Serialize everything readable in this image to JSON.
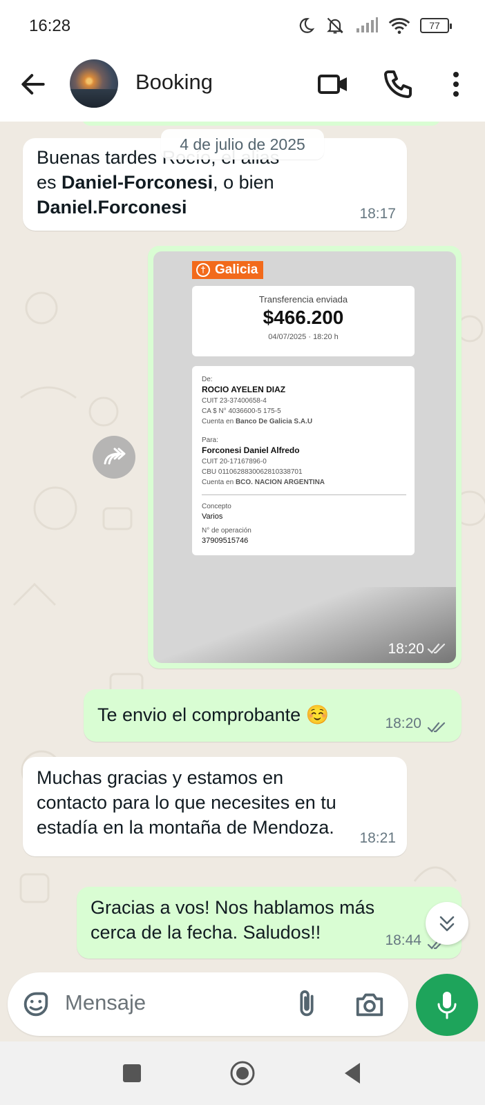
{
  "status_bar": {
    "time": "16:28",
    "battery": "77",
    "icons": [
      "moon-icon",
      "mute-icon",
      "signal-icon",
      "wifi-icon",
      "battery-icon"
    ]
  },
  "header": {
    "contact_name": "Booking",
    "icons": [
      "back-arrow-icon",
      "video-call-icon",
      "phone-icon",
      "more-options-icon"
    ]
  },
  "chat": {
    "date_chip": "4 de julio de 2025",
    "messages": [
      {
        "direction": "in",
        "lines": [
          {
            "parts": [
              {
                "text": "Buenas tardes Rocío, el alias",
                "bold": false
              }
            ]
          },
          {
            "parts": [
              {
                "text": "es ",
                "bold": false
              },
              {
                "text": "Daniel-Forconesi",
                "bold": true
              },
              {
                "text": ", o bien",
                "bold": false
              }
            ]
          },
          {
            "parts": [
              {
                "text": "Daniel.Forconesi",
                "bold": true
              }
            ]
          }
        ],
        "time": "18:17"
      },
      {
        "direction": "out",
        "type": "image",
        "time": "18:20",
        "receipt": {
          "bank": "Galicia",
          "title": "Transferencia enviada",
          "amount": "$466.200",
          "datetime": "04/07/2025 · 18:20 h",
          "from_label": "De:",
          "from_name": "ROCIO AYELEN DIAZ",
          "from_cuit": "CUIT 23-37400658-4",
          "from_account": "CA $ N° 4036600-5 175-5",
          "from_bank_prefix": "Cuenta en",
          "from_bank": "Banco De Galicia S.A.U",
          "to_label": "Para:",
          "to_name": "Forconesi Daniel Alfredo",
          "to_cuit": "CUIT 20-17167896-0",
          "to_cbu": "CBU 0110628830062810338701",
          "to_bank_prefix": "Cuenta en",
          "to_bank": "BCO. NACION ARGENTINA",
          "concept_label": "Concepto",
          "concept_value": "Varios",
          "op_label": "N° de operación",
          "op_value": "37909515746"
        }
      },
      {
        "direction": "out",
        "text": "Te envio el comprobante ☺️",
        "time": "18:20"
      },
      {
        "direction": "in",
        "lines": [
          "Muchas gracias y estamos en",
          "contacto para lo que necesites en tu",
          "estadía en la montaña de Mendoza."
        ],
        "time": "18:21"
      },
      {
        "direction": "out",
        "lines": [
          "Gracias a vos! Nos hablamos más",
          "cerca de la fecha. Saludos!!"
        ],
        "time": "18:44"
      }
    ]
  },
  "composer": {
    "placeholder": "Mensaje",
    "icons": [
      "sticker-icon",
      "attach-icon",
      "camera-icon",
      "mic-icon"
    ]
  },
  "colors": {
    "outgoing_bubble": "#d9fdd3",
    "incoming_bubble": "#ffffff",
    "chat_background": "#efeae2",
    "accent_green": "#1ea45b",
    "galicia_orange": "#f26a1b",
    "read_ticks": "#53bdeb"
  }
}
